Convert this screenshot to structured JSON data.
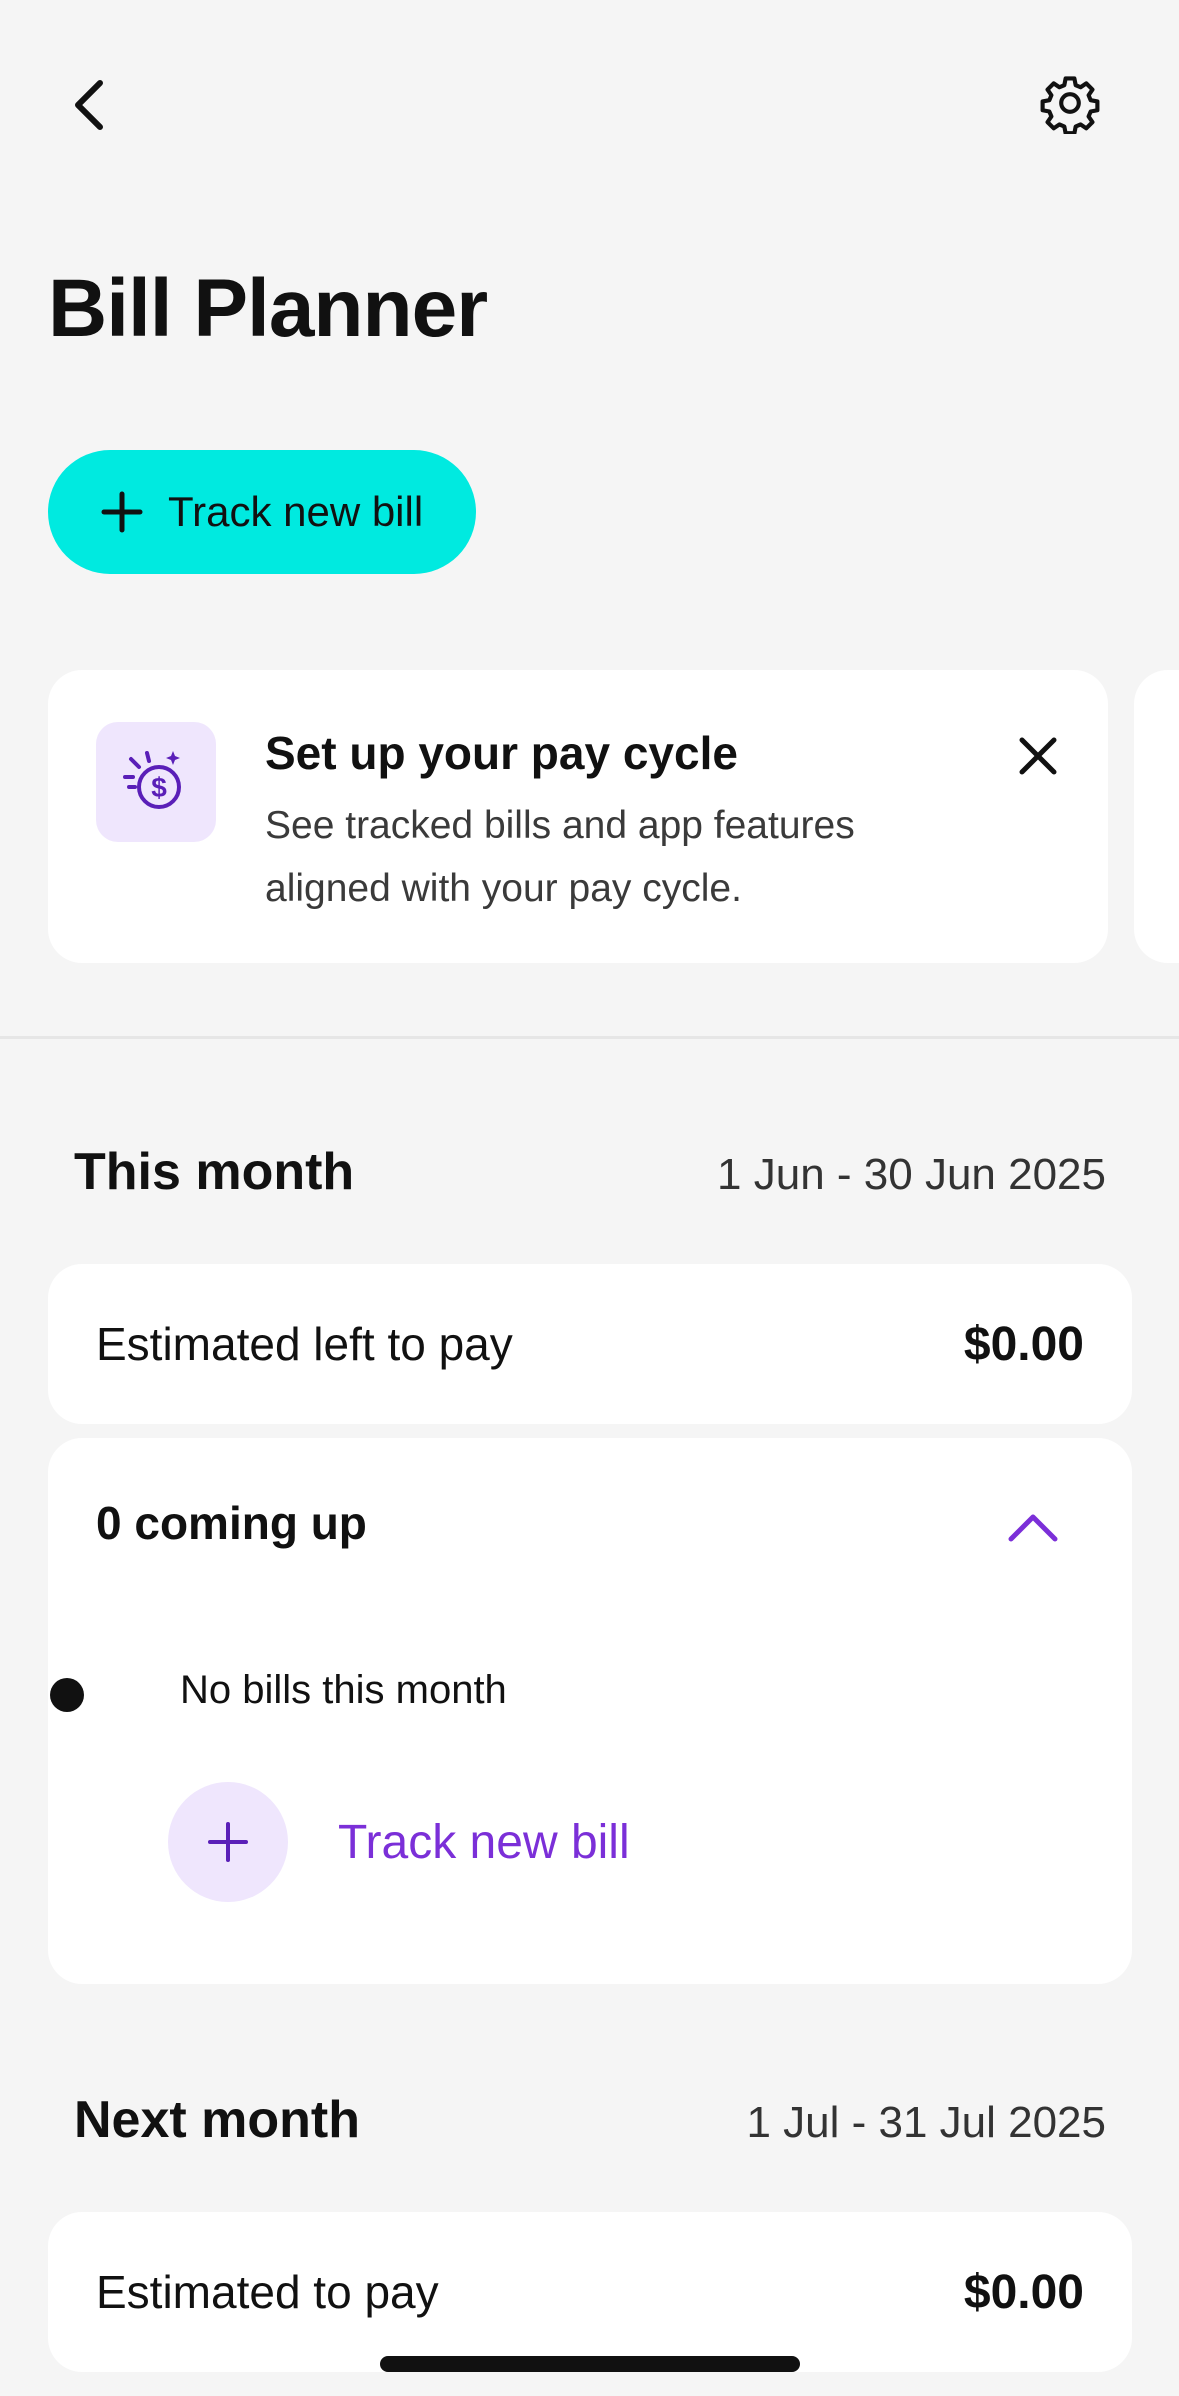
{
  "header": {
    "back_icon": "chevron-left-icon",
    "settings_icon": "gear-icon",
    "title": "Bill Planner"
  },
  "cta": {
    "icon": "plus-icon",
    "label": "Track new bill",
    "color": "#00eae0"
  },
  "promo": {
    "icon": "dollar-sparkle-icon",
    "title": "Set up your pay cycle",
    "body": "See tracked bills and app features aligned with your pay cycle.",
    "close_icon": "close-icon"
  },
  "this_month": {
    "title": "This month",
    "range": "1 Jun - 30 Jun 2025",
    "left_to_pay_label": "Estimated left to pay",
    "left_to_pay_amount": "$0.00",
    "coming_up_label": "0 coming up",
    "empty_label": "No bills this month",
    "track_label": "Track new bill",
    "accent": "#7b2fd8"
  },
  "next_month": {
    "title": "Next month",
    "range": "1 Jul - 31 Jul 2025",
    "to_pay_label": "Estimated to pay",
    "to_pay_amount": "$0.00"
  }
}
